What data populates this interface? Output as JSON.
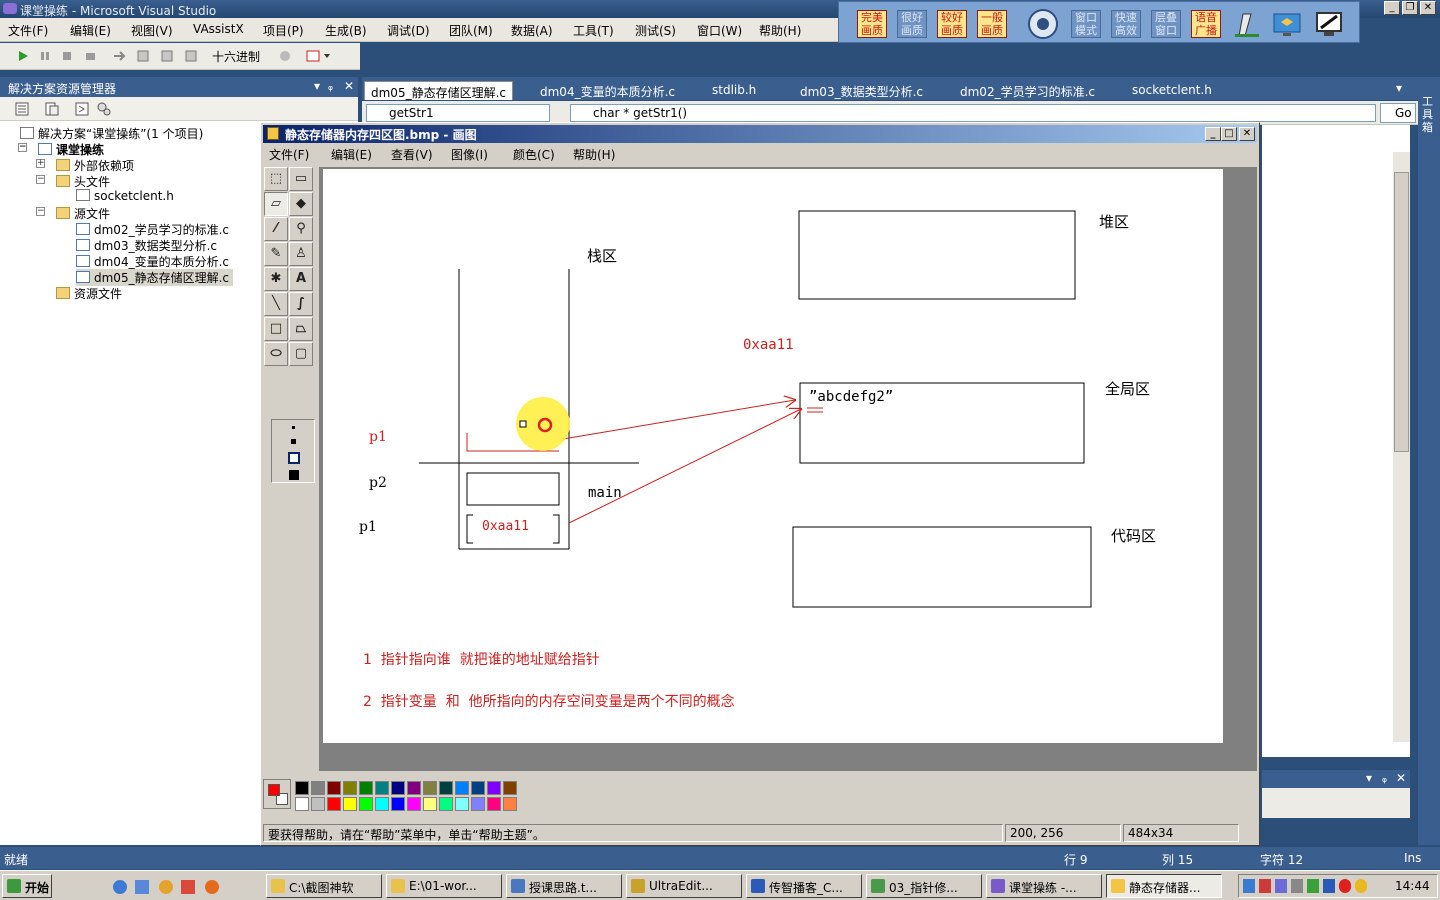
{
  "vs": {
    "title": "课堂操练 - Microsoft Visual Studio",
    "menu": [
      "文件(F)",
      "编辑(E)",
      "视图(V)",
      "VAssistX",
      "项目(P)",
      "生成(B)",
      "调试(D)",
      "团队(M)",
      "数据(A)",
      "工具(T)",
      "测试(S)",
      "窗口(W)",
      "帮助(H)"
    ],
    "toolbar_hex_label": "十六进制",
    "status": {
      "ready": "就绪",
      "line": "行 9",
      "col": "列 15",
      "char": "字符 12",
      "mode": "Ins"
    }
  },
  "quality_bar": [
    "完美画质",
    "很好画质",
    "较好画质",
    "一般画质",
    "窗口模式",
    "快速高效",
    "层叠窗口",
    "语音广播"
  ],
  "solution": {
    "header": "解决方案资源管理器",
    "root": "解决方案“课堂操练”(1 个项目)",
    "project": "课堂操练",
    "external": "外部依赖项",
    "headers": "头文件",
    "header_files": [
      "socketclent.h"
    ],
    "sources": "源文件",
    "source_files": [
      "dm02_学员学习的标准.c",
      "dm03_数据类型分析.c",
      "dm04_变量的本质分析.c",
      "dm05_静态存储区理解.c"
    ],
    "resources": "资源文件"
  },
  "editor": {
    "tabs": [
      "dm05_静态存储区理解.c",
      "dm04_变量的本质分析.c",
      "stdlib.h",
      "dm03_数据类型分析.c",
      "dm02_学员学习的标准.c",
      "socketclent.h"
    ],
    "scope_combo": "getStr1",
    "member_combo": "char * getStr1()",
    "go_label": "Go",
    "side_label": "工具箱"
  },
  "paint": {
    "title": "静态存储器内存四区图.bmp - 画图",
    "menu": [
      "文件(F)",
      "编辑(E)",
      "查看(V)",
      "图像(I)",
      "颜色(C)",
      "帮助(H)"
    ],
    "status_help": "要获得帮助，请在“帮助”菜单中，单击“帮助主题”。",
    "cursor_pos": "200, 256",
    "image_size": "484x34",
    "palette": [
      "#000000",
      "#808080",
      "#800000",
      "#808000",
      "#008000",
      "#008080",
      "#000080",
      "#800080",
      "#808040",
      "#004040",
      "#0080ff",
      "#004080",
      "#8000ff",
      "#804000",
      "#ffffff",
      "#c0c0c0",
      "#ff0000",
      "#ffff00",
      "#00ff00",
      "#00ffff",
      "#0000ff",
      "#ff00ff",
      "#ffff80",
      "#00ff80",
      "#80ffff",
      "#8080ff",
      "#ff0080",
      "#ff8040"
    ],
    "fg_color": "#ff0000",
    "bg_color": "#ffffff"
  },
  "diagram": {
    "stack": "栈区",
    "heap": "堆区",
    "global": "全局区",
    "code": "代码区",
    "addr_label": "0xaa11",
    "string_literal": "”abcdefg2”",
    "p1_top": "p1",
    "p2": "p2",
    "p1_bottom": "p1",
    "main_label": "main",
    "box_value": "0xaa11",
    "note1": "1  指针指向谁  就把谁的地址赋给指针",
    "note2": "2  指针变量  和  他所指向的内存空间变量是两个不同的概念"
  },
  "taskbar": {
    "start": "开始",
    "tasks": [
      "C:\\截图神软",
      "E:\\01-wor...",
      "授课思路.t...",
      "UltraEdit...",
      "传智播客_C...",
      "03_指针修...",
      "课堂操练 -...",
      "静态存储器..."
    ],
    "clock": "14:44"
  }
}
